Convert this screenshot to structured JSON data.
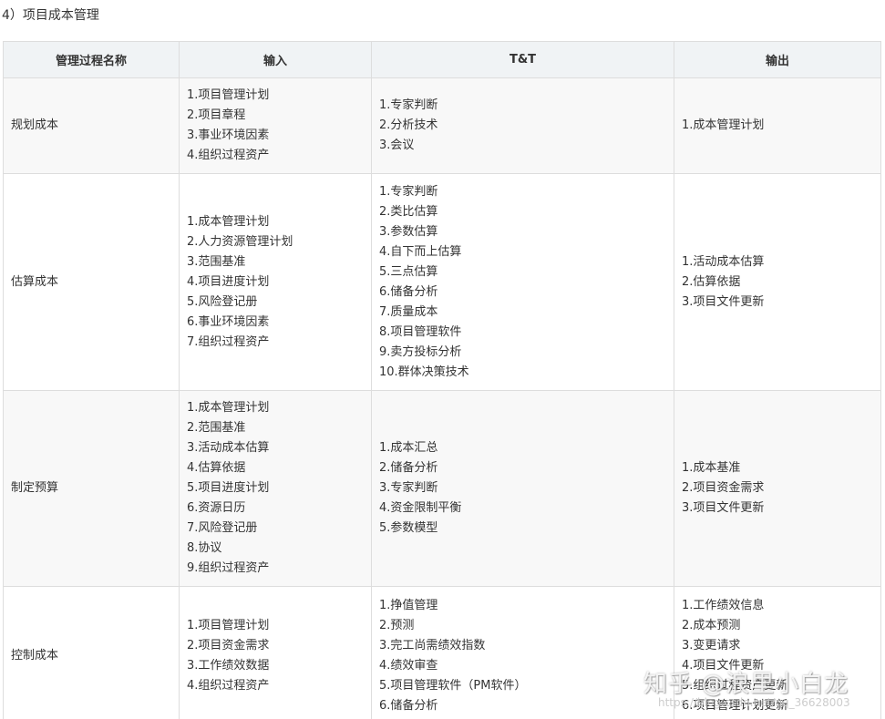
{
  "section_title": "4）项目成本管理",
  "table": {
    "headers": [
      "管理过程名称",
      "输入",
      "T&T",
      "输出"
    ],
    "rows": [
      {
        "name": "规划成本",
        "inputs": [
          "1.项目管理计划",
          "2.项目章程",
          "3.事业环境因素",
          "4.组织过程资产"
        ],
        "tools": [
          "1.专家判断",
          "2.分析技术",
          "3.会议"
        ],
        "outputs": [
          "1.成本管理计划"
        ]
      },
      {
        "name": "估算成本",
        "inputs": [
          "1.成本管理计划",
          "2.人力资源管理计划",
          "3.范围基准",
          "4.项目进度计划",
          "5.风险登记册",
          "6.事业环境因素",
          "7.组织过程资产"
        ],
        "tools": [
          "1.专家判断",
          "2.类比估算",
          "3.参数估算",
          "4.自下而上估算",
          "5.三点估算",
          "6.储备分析",
          "7.质量成本",
          "8.项目管理软件",
          "9.卖方投标分析",
          "10.群体决策技术"
        ],
        "outputs": [
          "1.活动成本估算",
          "2.估算依据",
          "3.项目文件更新"
        ]
      },
      {
        "name": "制定预算",
        "inputs": [
          "1.成本管理计划",
          "2.范围基准",
          "3.活动成本估算",
          "4.估算依据",
          "5.项目进度计划",
          "6.资源日历",
          "7.风险登记册",
          "8.协议",
          "9.组织过程资产"
        ],
        "tools": [
          "1.成本汇总",
          "2.储备分析",
          "3.专家判断",
          "4.资金限制平衡",
          "5.参数模型"
        ],
        "outputs": [
          "1.成本基准",
          "2.项目资金需求",
          "3.项目文件更新"
        ]
      },
      {
        "name": "控制成本",
        "inputs": [
          "1.项目管理计划",
          "2.项目资金需求",
          "3.工作绩效数据",
          "4.组织过程资产"
        ],
        "tools": [
          "1.挣值管理",
          "2.预测",
          "3.完工尚需绩效指数",
          "4.绩效审查",
          "5.项目管理软件（PM软件）",
          "6.储备分析"
        ],
        "outputs": [
          "1.工作绩效信息",
          "2.成本预测",
          "3.变更请求",
          "4.项目文件更新",
          "5.组织过程资产更新",
          "6.项目管理计划更新"
        ]
      }
    ]
  },
  "watermark": {
    "main": "知乎 @浪里小白龙",
    "sub": "https://blog.csdn.net/qq_36628003"
  }
}
